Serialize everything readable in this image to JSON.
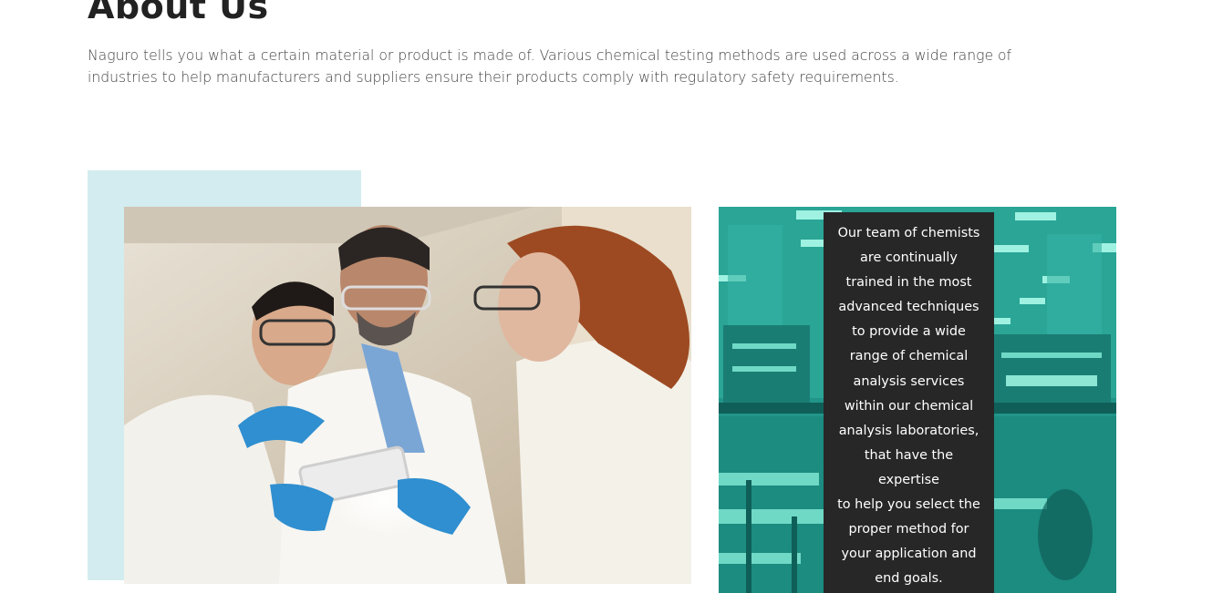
{
  "section": {
    "title": "About Us",
    "intro": "Naguro tells you what a certain material or product is made of. Various chemical testing methods are used across a wide range of industries to help manufacturers and suppliers ensure their products comply with regulatory safety requirements."
  },
  "card": {
    "text": "Our team of chemists\nare continually\ntrained in the most\nadvanced techniques\nto provide a wide\nrange of chemical\nanalysis services\nwithin our chemical\nanalysis laboratories,\nthat have the\nexpertise\nto help you select the\nproper method for\nyour application and\nend goals."
  },
  "colors": {
    "accent_block": "#d3ecef",
    "teal_overlay": "#1f8f84",
    "card_background": "#272727",
    "heading": "#222222",
    "body_text": "#444444"
  }
}
